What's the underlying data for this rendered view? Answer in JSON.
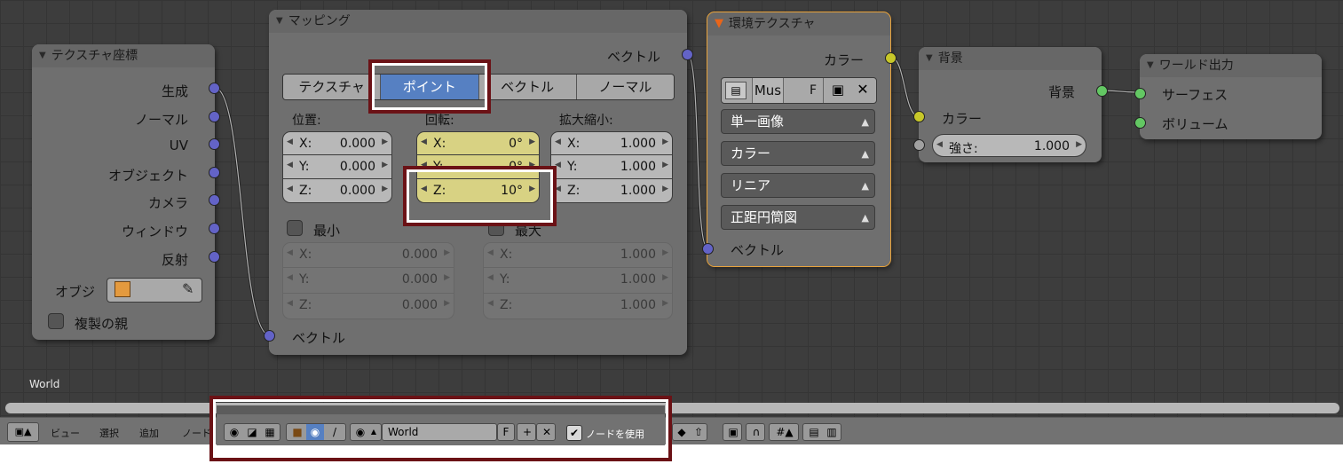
{
  "editor": {
    "world_label": "World"
  },
  "nodes": {
    "tex_coord": {
      "title": "テクスチャ座標",
      "outputs": [
        "生成",
        "ノーマル",
        "UV",
        "オブジェクト",
        "カメラ",
        "ウィンドウ",
        "反射"
      ],
      "object_label": "オブジ",
      "dupli_label": "複製の親"
    },
    "mapping": {
      "title": "マッピング",
      "output_label": "ベクトル",
      "modes": [
        "テクスチャ",
        "ポイント",
        "ベクトル",
        "ノーマル"
      ],
      "selected_mode": "ポイント",
      "location_label": "位置:",
      "rotation_label": "回転:",
      "scale_label": "拡大縮小:",
      "location": [
        {
          "axis": "X:",
          "value": "0.000"
        },
        {
          "axis": "Y:",
          "value": "0.000"
        },
        {
          "axis": "Z:",
          "value": "0.000"
        }
      ],
      "rotation": [
        {
          "axis": "X:",
          "value": "0°"
        },
        {
          "axis": "Y:",
          "value": "0°"
        },
        {
          "axis": "Z:",
          "value": "10°"
        }
      ],
      "scale": [
        {
          "axis": "X:",
          "value": "1.000"
        },
        {
          "axis": "Y:",
          "value": "1.000"
        },
        {
          "axis": "Z:",
          "value": "1.000"
        }
      ],
      "min_label": "最小",
      "max_label": "最大",
      "min": [
        {
          "axis": "X:",
          "value": "0.000"
        },
        {
          "axis": "Y:",
          "value": "0.000"
        },
        {
          "axis": "Z:",
          "value": "0.000"
        }
      ],
      "max": [
        {
          "axis": "X:",
          "value": "1.000"
        },
        {
          "axis": "Y:",
          "value": "1.000"
        },
        {
          "axis": "Z:",
          "value": "1.000"
        }
      ],
      "input_label": "ベクトル"
    },
    "env_tex": {
      "title": "環境テクスチャ",
      "output_label": "カラー",
      "image_name": "Mus",
      "fake_user": "F",
      "source": "単一画像",
      "color_space": "カラー",
      "interpolation": "リニア",
      "projection": "正距円筒図",
      "input_label": "ベクトル"
    },
    "background": {
      "title": "背景",
      "output_label": "背景",
      "color_label": "カラー",
      "strength_label": "強さ:",
      "strength_value": "1.000"
    },
    "world_output": {
      "title": "ワールド出力",
      "inputs": [
        "サーフェス",
        "ボリューム"
      ]
    }
  },
  "header": {
    "menu": [
      "ビュー",
      "選択",
      "追加",
      "ノード"
    ],
    "world_name": "World",
    "fake_user": "F",
    "use_nodes_label": "ノードを使用"
  },
  "colors": {
    "highlight": "#6b1216",
    "selected_button": "#5680c2",
    "socket_vector": "#6363c7",
    "socket_color": "#c7c729",
    "socket_shader": "#63c763"
  }
}
